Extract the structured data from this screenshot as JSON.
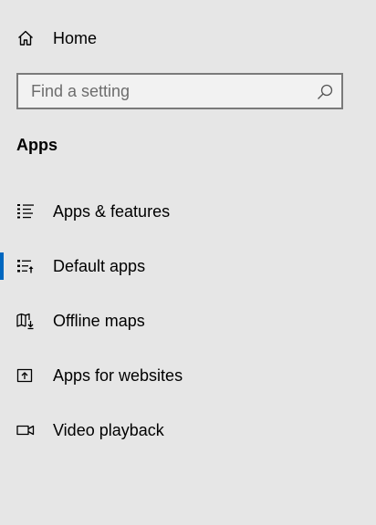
{
  "home": {
    "label": "Home",
    "icon": "home-icon"
  },
  "search": {
    "placeholder": "Find a setting",
    "value": "",
    "icon": "search-icon"
  },
  "section": {
    "title": "Apps"
  },
  "nav": {
    "items": [
      {
        "label": "Apps & features",
        "icon": "apps-features-icon",
        "selected": false
      },
      {
        "label": "Default apps",
        "icon": "default-apps-icon",
        "selected": true
      },
      {
        "label": "Offline maps",
        "icon": "offline-maps-icon",
        "selected": false
      },
      {
        "label": "Apps for websites",
        "icon": "apps-for-websites-icon",
        "selected": false
      },
      {
        "label": "Video playback",
        "icon": "video-playback-icon",
        "selected": false
      }
    ]
  },
  "colors": {
    "background": "#e6e6e6",
    "accent": "#0067c0",
    "search_border": "#7a7a7a",
    "search_background": "#f2f2f2"
  }
}
